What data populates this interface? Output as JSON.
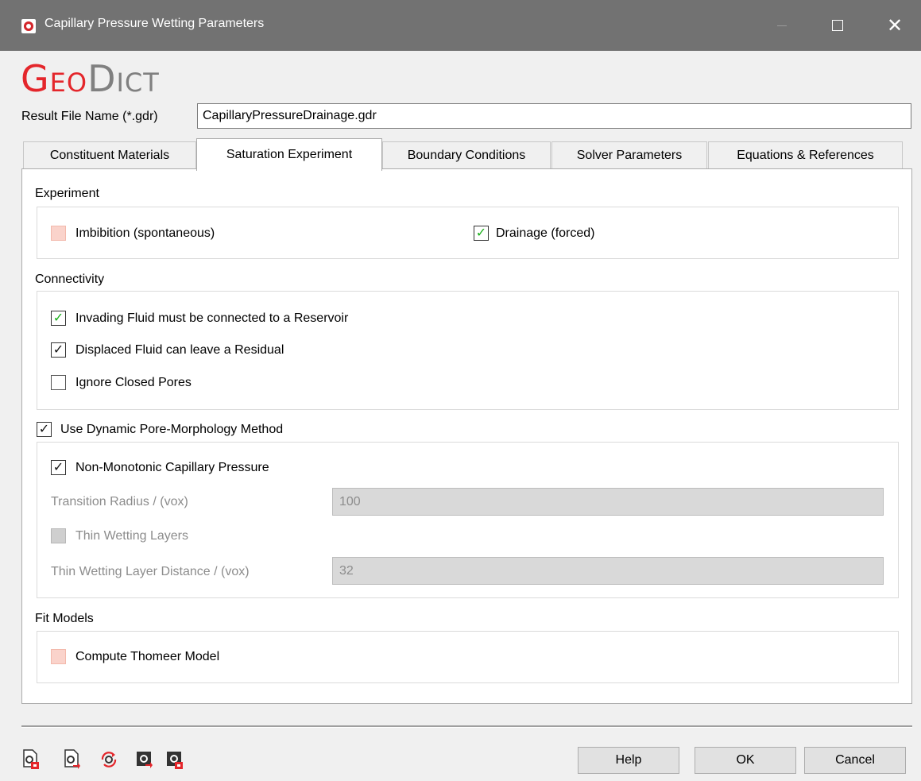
{
  "window": {
    "title": "Capillary Pressure Wetting Parameters",
    "minimize_symbol": "",
    "close_symbol": "✕"
  },
  "logo": {
    "geo": "Geo",
    "dict": "Dict"
  },
  "result_file": {
    "label": "Result File Name (*.gdr)",
    "value": "CapillaryPressureDrainage.gdr"
  },
  "tabs": [
    {
      "label": "Constituent Materials",
      "active": false
    },
    {
      "label": "Saturation Experiment",
      "active": true
    },
    {
      "label": "Boundary Conditions",
      "active": false
    },
    {
      "label": "Solver Parameters",
      "active": false
    },
    {
      "label": "Equations & References",
      "active": false
    }
  ],
  "experiment": {
    "label": "Experiment",
    "imbibition": {
      "label": "Imbibition (spontaneous)",
      "checked": false
    },
    "drainage": {
      "label": "Drainage (forced)",
      "checked": true
    }
  },
  "connectivity": {
    "label": "Connectivity",
    "invading": {
      "label": "Invading Fluid must be connected to a Reservoir",
      "checked": true
    },
    "displaced": {
      "label": "Displaced Fluid can leave a Residual",
      "checked": true
    },
    "ignore_closed": {
      "label": "Ignore Closed Pores",
      "checked": false
    }
  },
  "dynamic": {
    "label": "Use Dynamic Pore-Morphology Method",
    "checked": true,
    "non_monotonic": {
      "label": "Non-Monotonic Capillary Pressure",
      "checked": true
    },
    "transition_radius": {
      "label": "Transition Radius / (vox)",
      "value": "100"
    },
    "thin_layers": {
      "label": "Thin Wetting Layers",
      "checked": false
    },
    "thin_layer_distance": {
      "label": "Thin Wetting Layer Distance / (vox)",
      "value": "32"
    }
  },
  "fit_models": {
    "label": "Fit Models",
    "thomeer": {
      "label": "Compute Thomeer Model",
      "checked": false
    }
  },
  "check_mark": "✓",
  "buttons": {
    "help": "Help",
    "ok": "OK",
    "cancel": "Cancel"
  },
  "colors": {
    "titlebar": "#727272",
    "brand_red": "#e4262b",
    "check_green": "#19b019",
    "unchecked_pink": "#fad3cb"
  },
  "toolbar_icons": [
    "load-settings-icon",
    "save-settings-icon",
    "reset-settings-icon",
    "macro-settings-icon",
    "export-settings-icon"
  ]
}
